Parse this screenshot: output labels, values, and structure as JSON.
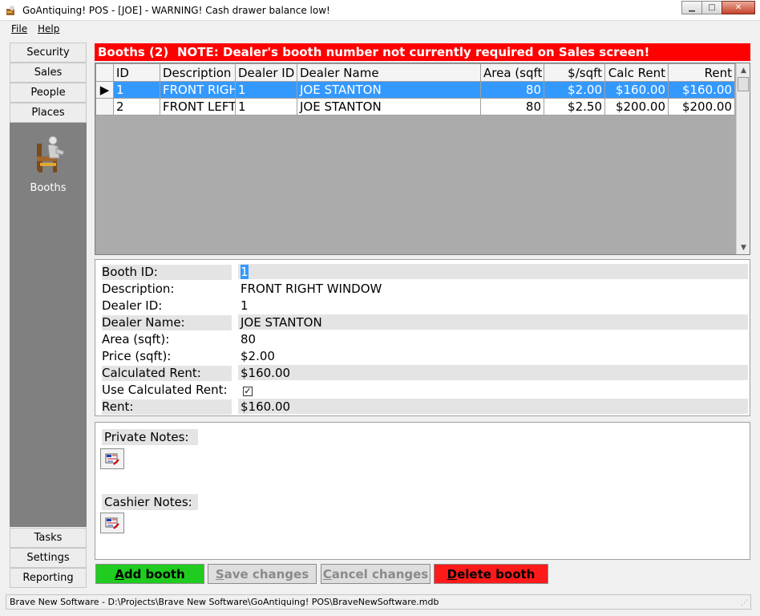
{
  "window": {
    "title": "GoAntiquing! POS - [JOE] - WARNING! Cash drawer balance low!",
    "minimize": "▁",
    "maximize": "□",
    "close": "✕"
  },
  "menu": {
    "file": "File",
    "help": "Help"
  },
  "sidebar": {
    "top_items": [
      {
        "label": "Security"
      },
      {
        "label": "Sales"
      },
      {
        "label": "People"
      },
      {
        "label": "Places"
      }
    ],
    "panel_item": {
      "label": "Booths",
      "icon": "booth-chair-icon"
    },
    "bottom_items": [
      {
        "label": "Tasks"
      },
      {
        "label": "Settings"
      },
      {
        "label": "Reporting"
      }
    ]
  },
  "banner": {
    "count_label": "Booths (2)",
    "note": "NOTE: Dealer's booth number not currently required on Sales screen!",
    "color": "#ff0000"
  },
  "grid": {
    "columns": [
      "ID",
      "Description",
      "Dealer ID",
      "Dealer Name",
      "Area (sqft)",
      "$/sqft",
      "Calc Rent",
      "Rent"
    ],
    "rows": [
      {
        "selected": true,
        "cells": [
          "1",
          "FRONT RIGHT WINDOW",
          "1",
          "JOE STANTON",
          "80",
          "$2.00",
          "$160.00",
          "$160.00"
        ]
      },
      {
        "selected": false,
        "cells": [
          "2",
          "FRONT LEFT WINDOW",
          "1",
          "JOE STANTON",
          "80",
          "$2.50",
          "$200.00",
          "$200.00"
        ]
      }
    ],
    "selection_color": "#3399ff"
  },
  "details": {
    "fields": [
      {
        "label": "Booth ID:",
        "value": "1"
      },
      {
        "label": "Description:",
        "value": "FRONT RIGHT WINDOW"
      },
      {
        "label": "Dealer ID:",
        "value": "1"
      },
      {
        "label": "Dealer Name:",
        "value": "JOE STANTON"
      },
      {
        "label": "Area (sqft):",
        "value": "80"
      },
      {
        "label": "Price (sqft):",
        "value": "$2.00"
      },
      {
        "label": "Calculated Rent:",
        "value": "$160.00"
      },
      {
        "label": "Use Calculated Rent:",
        "checked": true
      },
      {
        "label": "Rent:",
        "value": "$160.00"
      }
    ]
  },
  "notes": {
    "private_label": "Private Notes:",
    "cashier_label": "Cashier Notes:"
  },
  "buttons": {
    "add": {
      "first": "A",
      "rest": "dd booth",
      "color": "#1fcc1f"
    },
    "save": {
      "first": "S",
      "rest": "ave changes"
    },
    "cancel": {
      "first": "C",
      "rest": "ancel changes"
    },
    "delete": {
      "first": "D",
      "rest": "elete booth",
      "color": "#ff1a1a"
    }
  },
  "status": {
    "text": "Brave New Software - D:\\Projects\\Brave New Software\\GoAntiquing! POS\\BraveNewSoftware.mdb"
  }
}
